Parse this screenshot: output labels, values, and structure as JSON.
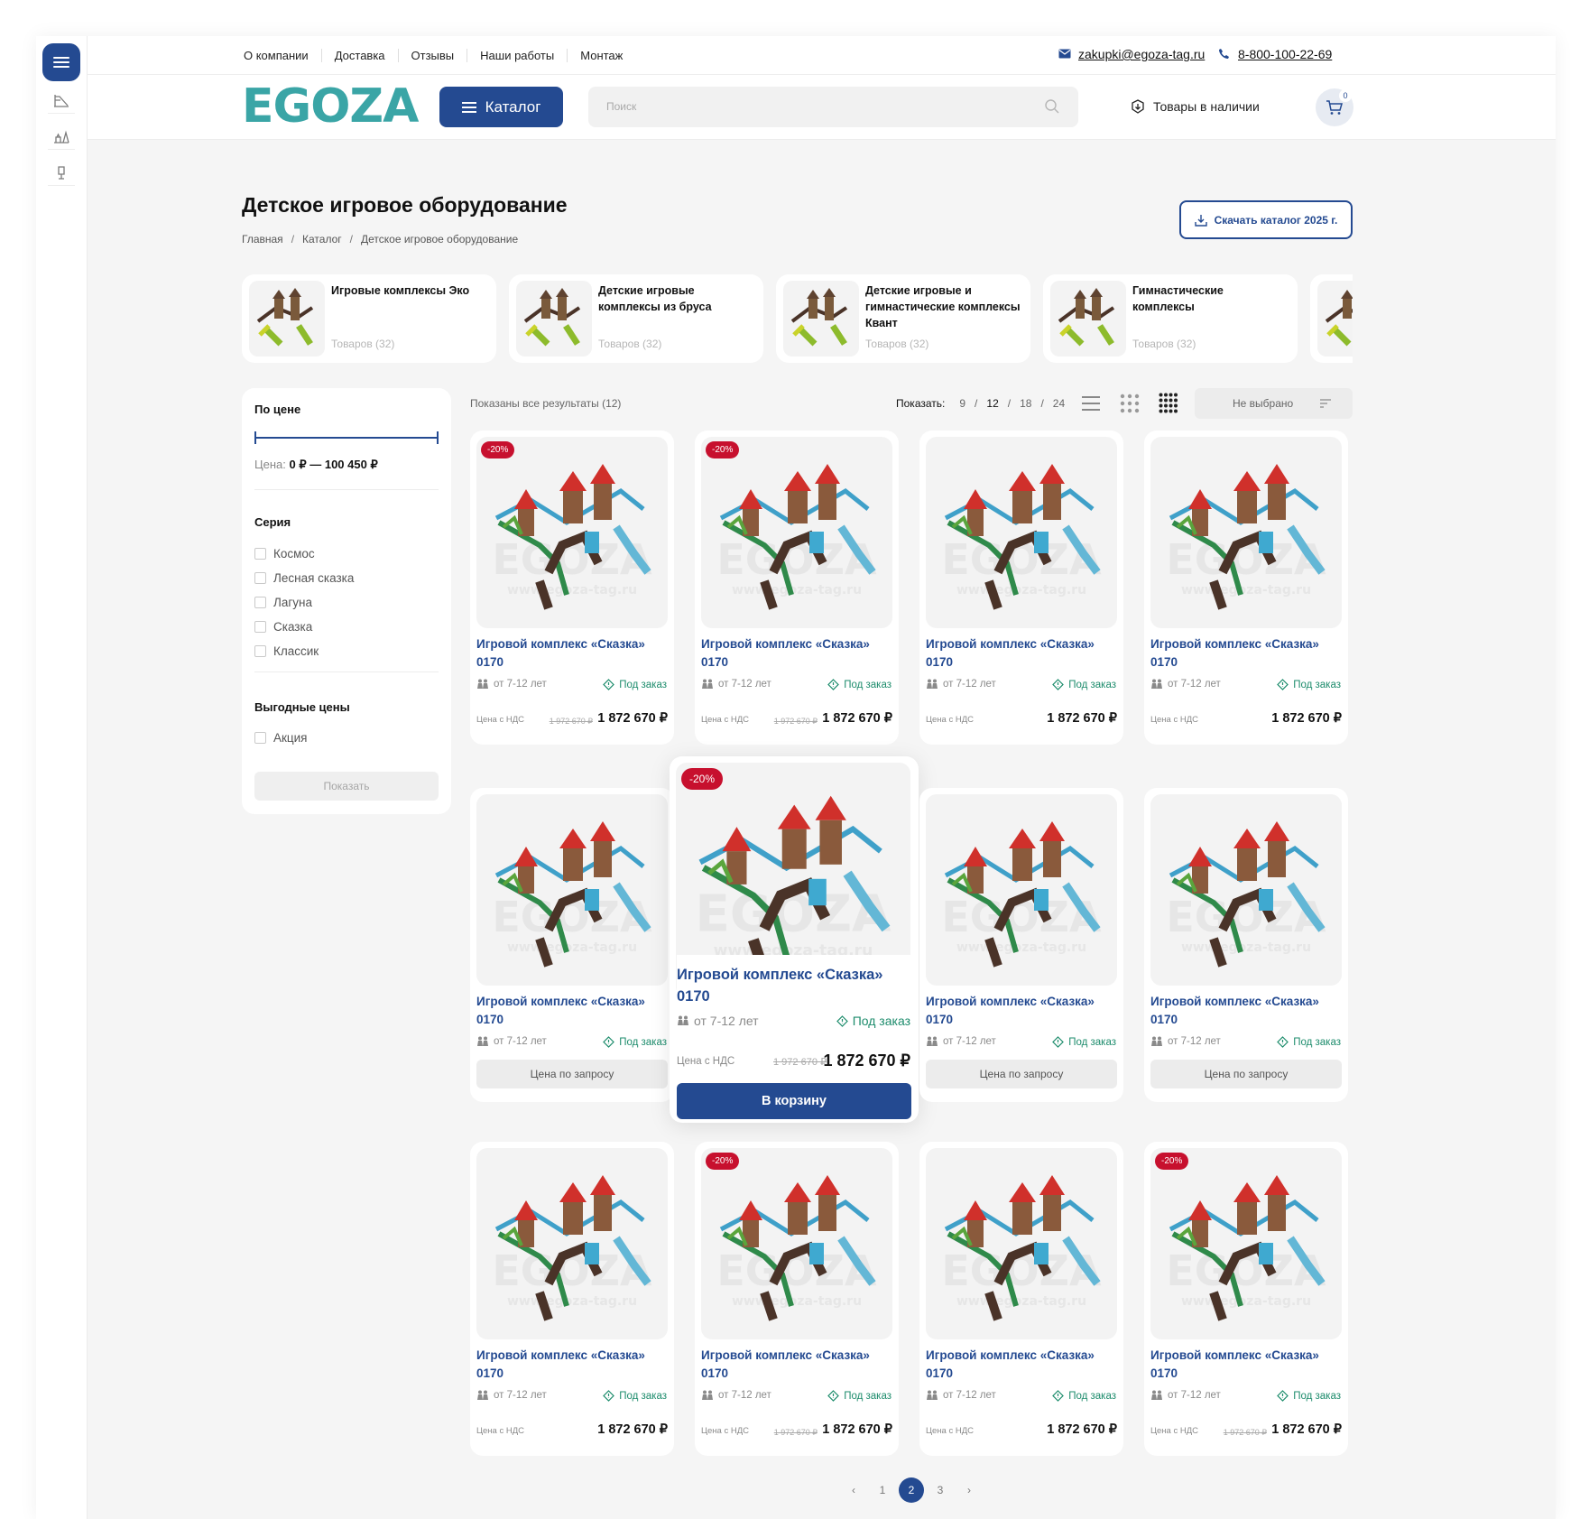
{
  "top_nav": [
    "О компании",
    "Доставка",
    "Отзывы",
    "Наши работы",
    "Монтаж"
  ],
  "contacts": {
    "email": "zakupki@egoza-tag.ru",
    "phone": "8-800-100-22-69"
  },
  "header": {
    "logo": "EGOZA",
    "catalog_button": "Каталог",
    "search_placeholder": "Поиск",
    "stock_link": "Товары в наличии",
    "cart_count": "0"
  },
  "page": {
    "title": "Детское игровое оборудование",
    "download_button": "Скачать каталог 2025 г."
  },
  "breadcrumbs": [
    "Главная",
    "Каталог",
    "Детское игровое оборудование"
  ],
  "categories": [
    {
      "name": "Игровые комплексы Эко",
      "count": "Товаров (32)"
    },
    {
      "name": "Детские игровые комплексы из бруса",
      "count": "Товаров (32)"
    },
    {
      "name": "Детские игровые и гимнастические комплексы Квант",
      "count": "Товаров (32)"
    },
    {
      "name": "Гимнастические комплексы",
      "count": "Товаров (32)"
    }
  ],
  "filters": {
    "price_title": "По цене",
    "price_label": "Цена:",
    "price_range": "0 ₽ — 100 450 ₽",
    "series_title": "Серия",
    "series": [
      "Космос",
      "Лесная сказка",
      "Лагуна",
      "Сказка",
      "Классик"
    ],
    "deals_title": "Выгодные цены",
    "deals": [
      "Акция"
    ],
    "apply_button": "Показать"
  },
  "toolbar": {
    "results_text": "Показаны все результаты (12)",
    "show_label": "Показать:",
    "per_page_options": [
      "9",
      "12",
      "18",
      "24"
    ],
    "per_page_selected": "12",
    "sort_value": "Не выбрано"
  },
  "product_common": {
    "name": "Игровой комплекс «Сказка» 0170",
    "age": "от 7-12 лет",
    "availability": "Под заказ",
    "price_label": "Цена с НДС",
    "old_price": "1 972 670 ₽",
    "price": "1 872 670 ₽",
    "price_on_request": "Цена по запросу",
    "discount": "-20%",
    "add_to_cart": "В корзину"
  },
  "products": [
    {
      "discount": true,
      "old_price": true,
      "mode": "price"
    },
    {
      "discount": true,
      "old_price": true,
      "mode": "price"
    },
    {
      "discount": false,
      "old_price": false,
      "mode": "price"
    },
    {
      "discount": false,
      "old_price": false,
      "mode": "price"
    },
    {
      "discount": false,
      "old_price": false,
      "mode": "request"
    },
    {
      "discount": true,
      "old_price": true,
      "mode": "hover"
    },
    {
      "discount": false,
      "old_price": false,
      "mode": "request"
    },
    {
      "discount": false,
      "old_price": false,
      "mode": "request"
    },
    {
      "discount": false,
      "old_price": false,
      "mode": "price"
    },
    {
      "discount": true,
      "old_price": true,
      "mode": "price"
    },
    {
      "discount": false,
      "old_price": false,
      "mode": "price"
    },
    {
      "discount": true,
      "old_price": true,
      "mode": "price"
    }
  ],
  "pagination": {
    "pages": [
      "1",
      "2",
      "3"
    ],
    "current": "2"
  },
  "colors": {
    "primary": "#244a91",
    "brand": "#3aa5a6",
    "sale": "#c7102e",
    "available": "#1d8c6c"
  },
  "icons": {
    "rail": [
      "slide-icon",
      "playground-icon",
      "lamp-icon"
    ],
    "search": "search-icon",
    "cart": "cart-icon",
    "download": "download-icon"
  }
}
